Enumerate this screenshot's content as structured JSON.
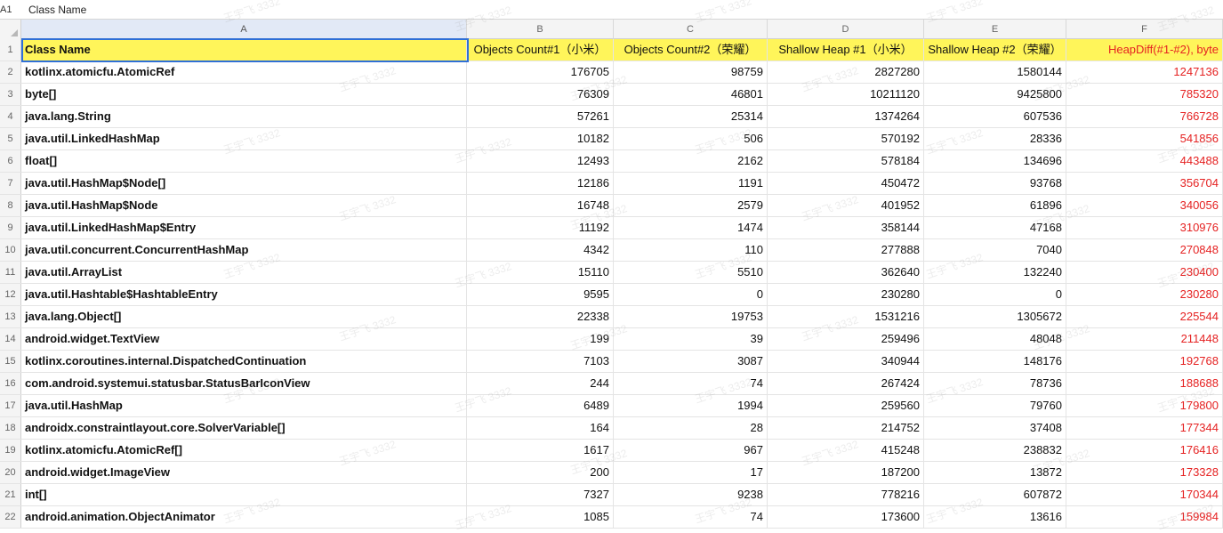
{
  "formula_bar": {
    "cell_ref": "A1",
    "content": "Class Name"
  },
  "columns": [
    {
      "letter": "A"
    },
    {
      "letter": "B"
    },
    {
      "letter": "C"
    },
    {
      "letter": "D"
    },
    {
      "letter": "E"
    },
    {
      "letter": "F"
    }
  ],
  "header": {
    "row_number": "1",
    "cells": [
      "Class Name",
      "Objects Count#1（小米）",
      "Objects Count#2（荣耀）",
      "Shallow Heap #1（小米）",
      "Shallow Heap #2（荣耀）",
      "HeapDiff(#1-#2), byte"
    ]
  },
  "rows": [
    {
      "n": "2",
      "cells": [
        "kotlinx.atomicfu.AtomicRef",
        "176705",
        "98759",
        "2827280",
        "1580144",
        "1247136"
      ]
    },
    {
      "n": "3",
      "cells": [
        "byte[]",
        "76309",
        "46801",
        "10211120",
        "9425800",
        "785320"
      ]
    },
    {
      "n": "4",
      "cells": [
        "java.lang.String",
        "57261",
        "25314",
        "1374264",
        "607536",
        "766728"
      ]
    },
    {
      "n": "5",
      "cells": [
        "java.util.LinkedHashMap",
        "10182",
        "506",
        "570192",
        "28336",
        "541856"
      ]
    },
    {
      "n": "6",
      "cells": [
        "float[]",
        "12493",
        "2162",
        "578184",
        "134696",
        "443488"
      ]
    },
    {
      "n": "7",
      "cells": [
        "java.util.HashMap$Node[]",
        "12186",
        "1191",
        "450472",
        "93768",
        "356704"
      ]
    },
    {
      "n": "8",
      "cells": [
        "java.util.HashMap$Node",
        "16748",
        "2579",
        "401952",
        "61896",
        "340056"
      ]
    },
    {
      "n": "9",
      "cells": [
        "java.util.LinkedHashMap$Entry",
        "11192",
        "1474",
        "358144",
        "47168",
        "310976"
      ]
    },
    {
      "n": "10",
      "cells": [
        "java.util.concurrent.ConcurrentHashMap",
        "4342",
        "110",
        "277888",
        "7040",
        "270848"
      ]
    },
    {
      "n": "11",
      "cells": [
        "java.util.ArrayList",
        "15110",
        "5510",
        "362640",
        "132240",
        "230400"
      ]
    },
    {
      "n": "12",
      "cells": [
        "java.util.Hashtable$HashtableEntry",
        "9595",
        "0",
        "230280",
        "0",
        "230280"
      ]
    },
    {
      "n": "13",
      "cells": [
        "java.lang.Object[]",
        "22338",
        "19753",
        "1531216",
        "1305672",
        "225544"
      ]
    },
    {
      "n": "14",
      "cells": [
        "android.widget.TextView",
        "199",
        "39",
        "259496",
        "48048",
        "211448"
      ]
    },
    {
      "n": "15",
      "cells": [
        "kotlinx.coroutines.internal.DispatchedContinuation",
        "7103",
        "3087",
        "340944",
        "148176",
        "192768"
      ]
    },
    {
      "n": "16",
      "cells": [
        "com.android.systemui.statusbar.StatusBarIconView",
        "244",
        "74",
        "267424",
        "78736",
        "188688"
      ]
    },
    {
      "n": "17",
      "cells": [
        "java.util.HashMap",
        "6489",
        "1994",
        "259560",
        "79760",
        "179800"
      ]
    },
    {
      "n": "18",
      "cells": [
        "androidx.constraintlayout.core.SolverVariable[]",
        "164",
        "28",
        "214752",
        "37408",
        "177344"
      ]
    },
    {
      "n": "19",
      "cells": [
        "kotlinx.atomicfu.AtomicRef[]",
        "1617",
        "967",
        "415248",
        "238832",
        "176416"
      ]
    },
    {
      "n": "20",
      "cells": [
        "android.widget.ImageView",
        "200",
        "17",
        "187200",
        "13872",
        "173328"
      ]
    },
    {
      "n": "21",
      "cells": [
        "int[]",
        "7327",
        "9238",
        "778216",
        "607872",
        "170344"
      ]
    },
    {
      "n": "22",
      "cells": [
        "android.animation.ObjectAnimator",
        "1085",
        "74",
        "173600",
        "13616",
        "159984"
      ]
    }
  ],
  "watermark_text": "王宇飞 3332",
  "colors": {
    "header_fill": "#fff55a",
    "diff_text": "#e52222",
    "selection": "#2f6fd6"
  }
}
